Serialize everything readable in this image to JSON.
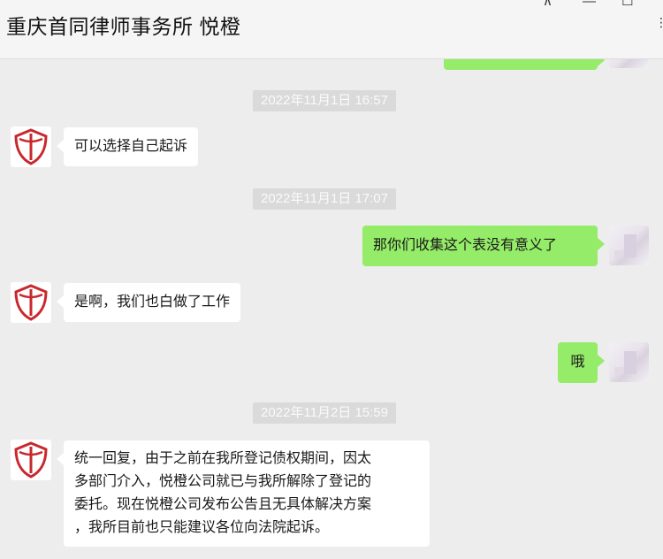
{
  "window": {
    "title": "重庆首同律师事务所 悦橙",
    "pin_glyph": "⊼",
    "minimize_glyph": "—",
    "maximize_glyph": "☐",
    "more_glyph": "⋮"
  },
  "colors": {
    "chat_background": "#ededed",
    "own_bubble": "#95ec69",
    "other_bubble": "#ffffff",
    "timestamp_bg": "#dadada",
    "logo_red": "#c8282d"
  },
  "messages": {
    "ts1": "2022年11月1日 16:57",
    "m1": "可以选择自己起诉",
    "ts2": "2022年11月1日 17:07",
    "m2": "那你们收集这个表没有意义了",
    "m3": "是啊，我们也白做了工作",
    "m4": "哦",
    "ts3": "2022年11月2日 15:59",
    "m5_lines": [
      "统一回复，由于之前在我所登记债权期间，因太",
      "多部门介入，悦橙公司就已与我所解除了登记的",
      "委托。现在悦橙公司发布公告且无具体解决方案",
      "，我所目前也只能建议各位向法院起诉。"
    ]
  }
}
